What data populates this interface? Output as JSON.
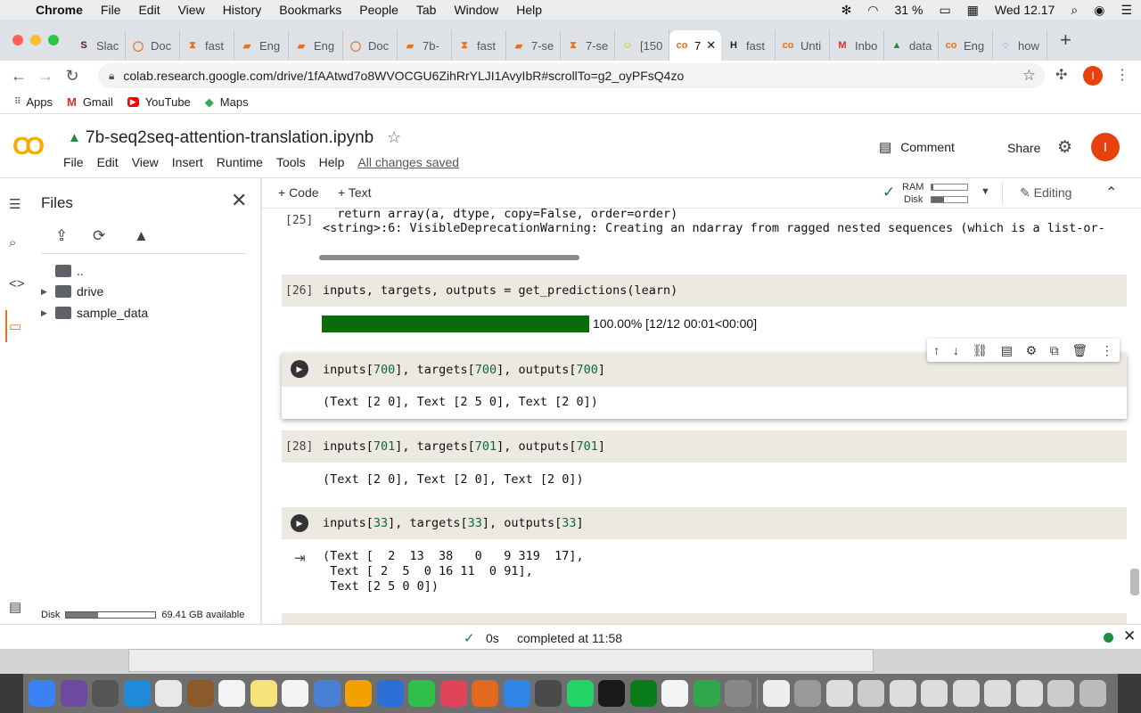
{
  "menubar": {
    "app": "Chrome",
    "items": [
      "File",
      "Edit",
      "View",
      "History",
      "Bookmarks",
      "People",
      "Tab",
      "Window",
      "Help"
    ],
    "battery": "31 %",
    "clock": "Wed 12.17"
  },
  "tabs": [
    {
      "label": "Slac",
      "fav": "S",
      "color": "#4a154b"
    },
    {
      "label": "Doc",
      "fav": "◯",
      "color": "#e8711a"
    },
    {
      "label": "fast",
      "fav": "⧗",
      "color": "#e8711a"
    },
    {
      "label": "Eng",
      "fav": "▰",
      "color": "#e8711a"
    },
    {
      "label": "Eng",
      "fav": "▰",
      "color": "#e8711a"
    },
    {
      "label": "Doc",
      "fav": "◯",
      "color": "#e8711a"
    },
    {
      "label": "7b-",
      "fav": "▰",
      "color": "#e8711a"
    },
    {
      "label": "fast",
      "fav": "⧗",
      "color": "#e8711a"
    },
    {
      "label": "7-se",
      "fav": "▰",
      "color": "#e8711a"
    },
    {
      "label": "7-se",
      "fav": "⧗",
      "color": "#e8711a"
    },
    {
      "label": "[150",
      "fav": "☺",
      "color": "#e0c000"
    },
    {
      "label": "7",
      "fav": "co",
      "color": "#e8711a",
      "active": true
    },
    {
      "label": "fast",
      "fav": "H",
      "color": "#222"
    },
    {
      "label": "Unti",
      "fav": "co",
      "color": "#e8711a"
    },
    {
      "label": "Inbo",
      "fav": "M",
      "color": "#d93025"
    },
    {
      "label": "data",
      "fav": "▲",
      "color": "#1e8e3e"
    },
    {
      "label": "Eng",
      "fav": "co",
      "color": "#e8711a"
    },
    {
      "label": "how",
      "fav": "◌",
      "color": "#1a73e8"
    }
  ],
  "toolbar": {
    "url": "colab.research.google.com/drive/1fAAtwd7o8WVOCGU6ZihRrYLJI1AvyIbR#scrollTo=g2_oyPFsQ4zo",
    "avatar": "I"
  },
  "bookmarks": [
    {
      "label": "Apps",
      "icon": "⋮⋮⋮",
      "color": "#444"
    },
    {
      "label": "Gmail",
      "icon": "M",
      "color": "#d93025"
    },
    {
      "label": "YouTube",
      "icon": "▶",
      "color": "#ff0000"
    },
    {
      "label": "Maps",
      "icon": "◆",
      "color": "#34a853"
    }
  ],
  "colab": {
    "title": "7b-seq2seq-attention-translation.ipynb",
    "menu": [
      "File",
      "Edit",
      "View",
      "Insert",
      "Runtime",
      "Tools",
      "Help"
    ],
    "saved": "All changes saved",
    "comment": "Comment",
    "share": "Share",
    "avatar": "I"
  },
  "files": {
    "title": "Files",
    "items": [
      {
        "label": "..",
        "type": "up"
      },
      {
        "label": "drive",
        "type": "folder"
      },
      {
        "label": "sample_data",
        "type": "folder"
      }
    ],
    "disk_label": "Disk",
    "disk_available": "69.41 GB available",
    "disk_used_fraction": 0.36
  },
  "nbtools": {
    "add_code": "+ Code",
    "add_text": "+ Text",
    "ram": "RAM",
    "disk": "Disk",
    "ram_fraction": 0.05,
    "disk_fraction": 0.35,
    "editing": "Editing"
  },
  "cells": {
    "c25_prompt": "[25]",
    "c25_line1": "  return array(a, dtype, copy=False, order=order)",
    "c25_line2": "<string>:6: VisibleDeprecationWarning: Creating an ndarray from ragged nested sequences (which is a list-or-",
    "c26_prompt": "[26]",
    "c26_src": "inputs, targets, outputs = get_predictions(learn)",
    "c26_progress_fraction": 1.0,
    "c26_progress_text": "100.00% [12/12 00:01<00:00]",
    "c27_src_a": "inputs[",
    "c27_n1": "700",
    "c27_src_b": "], targets[",
    "c27_n2": "700",
    "c27_src_c": "], outputs[",
    "c27_n3": "700",
    "c27_src_d": "]",
    "c27_out": "(Text [2 0], Text [2 5 0], Text [2 0])",
    "c28_prompt": "[28]",
    "c28_src_a": "inputs[",
    "c28_n1": "701",
    "c28_src_b": "], targets[",
    "c28_n2": "701",
    "c28_src_c": "], outputs[",
    "c28_n3": "701",
    "c28_src_d": "]",
    "c28_out": "(Text [2 0], Text [2 0], Text [2 0])",
    "c29_src_a": "inputs[",
    "c29_n1": "33",
    "c29_src_b": "], targets[",
    "c29_n2": "33",
    "c29_src_c": "], outputs[",
    "c29_n3": "33",
    "c29_src_d": "]",
    "c29_out1": "(Text [  2  13  38   0   9 319  17],",
    "c29_out2": " Text [ 2  5  0 16 11  0 91],",
    "c29_out3": " Text [2 5 0 0])"
  },
  "status": {
    "time": "0s",
    "text": "completed at 11:58"
  }
}
